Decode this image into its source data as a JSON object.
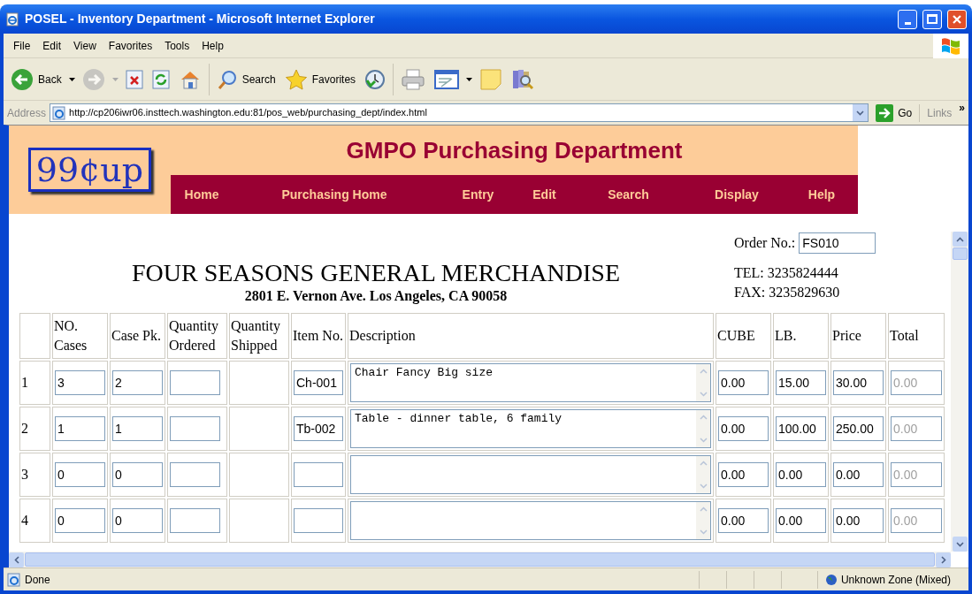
{
  "window": {
    "title": "POSEL - Inventory Department - Microsoft Internet Explorer"
  },
  "menu": [
    "File",
    "Edit",
    "View",
    "Favorites",
    "Tools",
    "Help"
  ],
  "toolbar": [
    {
      "kind": "back",
      "label": "Back",
      "disabled": false
    },
    {
      "kind": "forward",
      "disabled": true
    },
    {
      "kind": "stop"
    },
    {
      "kind": "refresh"
    },
    {
      "kind": "home"
    },
    {
      "kind": "search",
      "label": "Search"
    },
    {
      "kind": "favorites",
      "label": "Favorites"
    },
    {
      "kind": "history"
    },
    {
      "kind": "print"
    },
    {
      "kind": "edit"
    },
    {
      "kind": "note"
    },
    {
      "kind": "research"
    }
  ],
  "address_bar": {
    "label": "Address",
    "url": "http://cp206iwr06.insttech.washington.edu:81/pos_web/purchasing_dept/index.html",
    "go": "Go",
    "links": "Links",
    "links_chevron": "»"
  },
  "page": {
    "logo": "99¢up",
    "title": "GMPO Purchasing Department",
    "nav": [
      "Home",
      "Purchasing Home",
      "Entry",
      "Edit",
      "Search",
      "Display",
      "Help"
    ],
    "company": "FOUR SEASONS GENERAL MERCHANDISE",
    "address": "2801 E. Vernon Ave. Los Angeles, CA 90058",
    "order_label": "Order No.:",
    "order_no": "FS010",
    "tel": "TEL: 3235824444",
    "fax": "FAX: 3235829630",
    "table": {
      "columns": [
        "NO. Cases",
        "Case Pk.",
        "Quantity Ordered",
        "Quantity Shipped",
        "Item No.",
        "Description",
        "CUBE",
        "LB.",
        "Price",
        "Total"
      ],
      "rows": [
        {
          "number": "1",
          "cases": "3",
          "case_pk": "2",
          "item_no": "Ch-001",
          "description": "Chair Fancy Big size",
          "cube": "0.00",
          "lb": "15.00",
          "price": "30.00",
          "total": "0.00",
          "total_disabled": true
        },
        {
          "number": "2",
          "cases": "1",
          "case_pk": "1",
          "item_no": "Tb-002",
          "description": "Table - dinner table, 6 family",
          "cube": "0.00",
          "lb": "100.00",
          "price": "250.00",
          "total": "0.00",
          "total_disabled": true
        },
        {
          "number": "3",
          "cases": "0",
          "case_pk": "0",
          "cube": "0.00",
          "lb": "0.00",
          "price": "0.00",
          "total": "0.00",
          "total_disabled": true
        },
        {
          "number": "4",
          "cases": "0",
          "case_pk": "0",
          "cube": "0.00",
          "lb": "0.00",
          "price": "0.00",
          "total": "0.00",
          "total_disabled": true
        }
      ]
    }
  },
  "status_bar": {
    "text": "Done",
    "zone": "Unknown Zone (Mixed)"
  }
}
